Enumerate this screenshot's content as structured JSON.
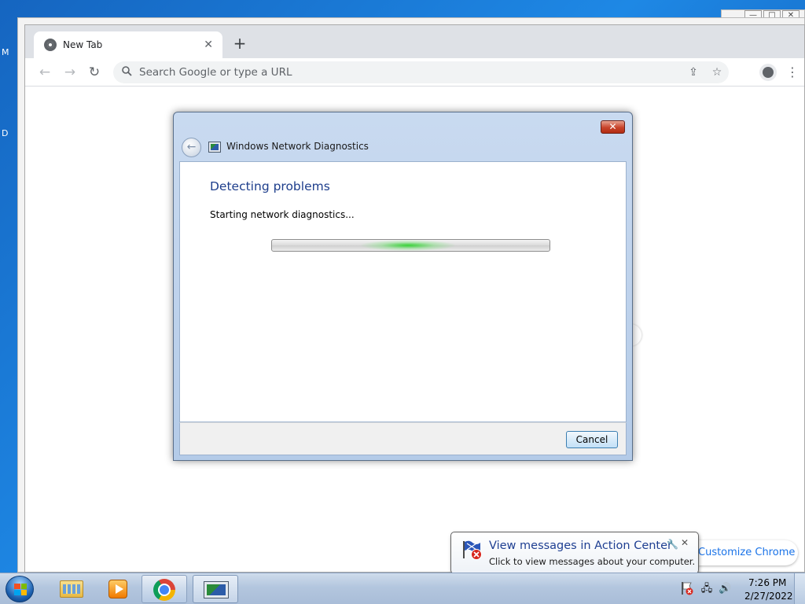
{
  "desktop": {
    "edge_letters": [
      "M",
      "D"
    ]
  },
  "background_windows": {
    "controls": [
      "—",
      "□",
      "✕"
    ]
  },
  "chrome": {
    "tab_title": "New Tab",
    "tab_close": "✕",
    "new_tab": "+",
    "back": "←",
    "forward": "→",
    "reload": "↻",
    "omnibox_placeholder": "Search Google or type a URL",
    "share": "⇪",
    "bookmark": "☆",
    "menu": "⋮",
    "customize_label": "Customize Chrome"
  },
  "dialog": {
    "title": "Windows Network Diagnostics",
    "close": "✕",
    "back": "←",
    "heading": "Detecting problems",
    "status": "Starting network diagnostics...",
    "progress_glow_center": 0.49,
    "progress_glow_width": 0.34,
    "cancel_label": "Cancel"
  },
  "balloon": {
    "title": "View messages in Action Center",
    "message": "Click to view messages about your computer.",
    "options": "🔧",
    "close": "✕"
  },
  "taskbar": {
    "clock_time": "7:26 PM",
    "clock_date": "2/27/2022",
    "tray_network": "🖧",
    "tray_volume": "🔊"
  },
  "colors": {
    "dialog_heading": "#1e3e8c",
    "balloon_title": "#1f3f92",
    "link_blue": "#1a73e8",
    "progress_green": "#30d230"
  }
}
